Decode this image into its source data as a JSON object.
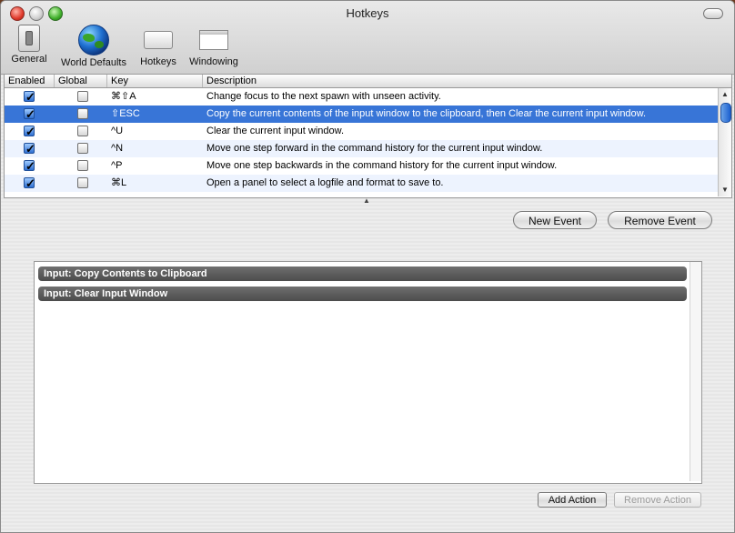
{
  "window": {
    "title": "Hotkeys"
  },
  "toolbar": {
    "items": [
      {
        "label": "General",
        "icon": "general-switch-icon"
      },
      {
        "label": "World Defaults",
        "icon": "globe-icon"
      },
      {
        "label": "Hotkeys",
        "icon": "keyboard-icon"
      },
      {
        "label": "Windowing",
        "icon": "window-icon"
      }
    ]
  },
  "table": {
    "columns": [
      "Enabled",
      "Global",
      "Key",
      "Description"
    ],
    "rows": [
      {
        "enabled": true,
        "global": false,
        "key": "⌘⇧A",
        "description": "Change focus to the next spawn with unseen activity."
      },
      {
        "enabled": true,
        "global": false,
        "key": "⇧ESC",
        "description": "Copy the current contents of the input window to the clipboard, then Clear the current input window.",
        "selected": true
      },
      {
        "enabled": true,
        "global": false,
        "key": "^U",
        "description": "Clear the current input window."
      },
      {
        "enabled": true,
        "global": false,
        "key": "^N",
        "description": "Move one step forward in the command history for the current input window."
      },
      {
        "enabled": true,
        "global": false,
        "key": "^P",
        "description": "Move one step backwards in the command history for the current input window."
      },
      {
        "enabled": true,
        "global": false,
        "key": "⌘L",
        "description": "Open a panel to select a logfile and format to save to."
      }
    ]
  },
  "buttons": {
    "new_event": "New Event",
    "remove_event": "Remove Event",
    "add_action": "Add Action",
    "remove_action": "Remove Action"
  },
  "actions": [
    {
      "label": "Input: Copy Contents to Clipboard"
    },
    {
      "label": "Input: Clear Input Window"
    }
  ],
  "colors": {
    "selection": "#3875d7",
    "stripe": "#edf3fe",
    "action_bar": "#555555"
  }
}
